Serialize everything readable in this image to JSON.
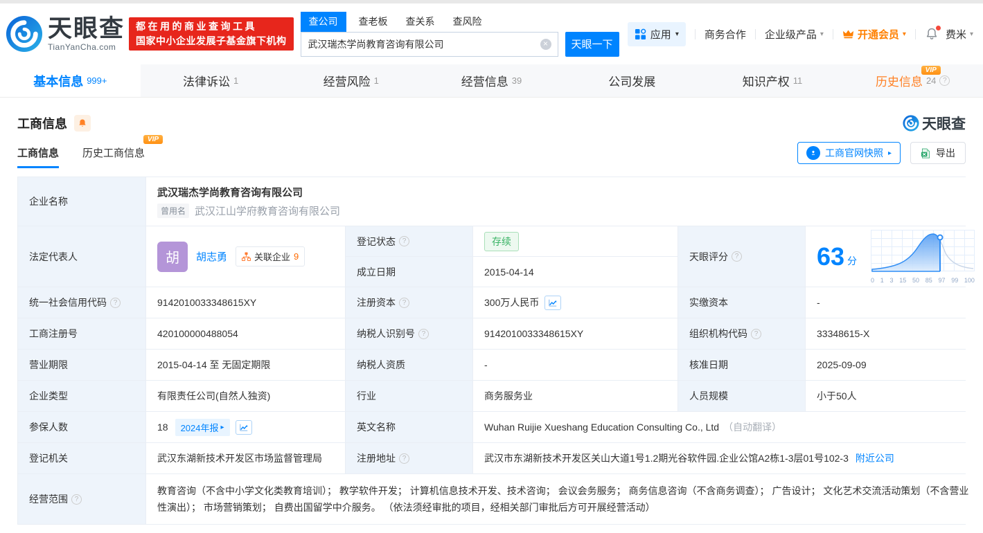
{
  "icons": {
    "help": "?",
    "caret_down": "▾",
    "caret_right": "▸",
    "clear": "×",
    "vip": "VIP"
  },
  "header": {
    "logo": {
      "brand": "天眼查",
      "domain": "TianYanCha.com"
    },
    "banner": {
      "line1": "都在用的商业查询工具",
      "line2": "国家中小企业发展子基金旗下机构"
    },
    "search": {
      "tabs": [
        {
          "label": "查公司"
        },
        {
          "label": "查老板"
        },
        {
          "label": "查关系"
        },
        {
          "label": "查风险"
        }
      ],
      "value": "武汉瑞杰学尚教育咨询有限公司",
      "button": "天眼一下"
    },
    "nav": {
      "apps": "应用",
      "coop": "商务合作",
      "enterprise": "企业级产品",
      "vip": "开通会员",
      "user": "费米"
    }
  },
  "main_tabs": [
    {
      "label": "基本信息",
      "count": "999+"
    },
    {
      "label": "法律诉讼",
      "count": "1"
    },
    {
      "label": "经营风险",
      "count": "1"
    },
    {
      "label": "经营信息",
      "count": "39"
    },
    {
      "label": "公司发展",
      "count": ""
    },
    {
      "label": "知识产权",
      "count": "11"
    },
    {
      "label": "历史信息",
      "count": "24"
    }
  ],
  "section": {
    "title": "工商信息",
    "watermark": "天眼查",
    "subtabs": [
      {
        "label": "工商信息"
      },
      {
        "label": "历史工商信息"
      }
    ],
    "snapshot_button": "工商官网快照",
    "export_button": "导出"
  },
  "table": {
    "company": {
      "label": "企业名称",
      "name": "武汉瑞杰学尚教育咨询有限公司",
      "former_badge": "曾用名",
      "former_name": "武汉江山学府教育咨询有限公司"
    },
    "legal_rep": {
      "label": "法定代表人",
      "avatar": "胡",
      "name": "胡志勇",
      "related_label": "关联企业",
      "related_count": "9"
    },
    "reg_status": {
      "label": "登记状态",
      "value": "存续"
    },
    "est_date": {
      "label": "成立日期",
      "value": "2015-04-14"
    },
    "score": {
      "label": "天眼评分",
      "value": "63",
      "unit": "分"
    },
    "credit_code": {
      "label": "统一社会信用代码",
      "value": "9142010033348615XY"
    },
    "reg_capital": {
      "label": "注册资本",
      "value": "300万人民币"
    },
    "paid_capital": {
      "label": "实缴资本",
      "value": "-"
    },
    "reg_number": {
      "label": "工商注册号",
      "value": "420100000488054"
    },
    "taxpayer_id": {
      "label": "纳税人识别号",
      "value": "9142010033348615XY"
    },
    "org_code": {
      "label": "组织机构代码",
      "value": "33348615-X"
    },
    "business_term": {
      "label": "营业期限",
      "value": "2015-04-14 至 无固定期限"
    },
    "taxpayer_quality": {
      "label": "纳税人资质",
      "value": "-"
    },
    "approval_date": {
      "label": "核准日期",
      "value": "2025-09-09"
    },
    "company_type": {
      "label": "企业类型",
      "value": "有限责任公司(自然人独资)"
    },
    "industry": {
      "label": "行业",
      "value": "商务服务业"
    },
    "staff_size": {
      "label": "人员规模",
      "value": "小于50人"
    },
    "insured": {
      "label": "参保人数",
      "value": "18",
      "report_badge": "2024年报"
    },
    "english_name": {
      "label": "英文名称",
      "value": "Wuhan Ruijie Xueshang Education Consulting Co., Ltd",
      "note": "（自动翻译）"
    },
    "reg_authority": {
      "label": "登记机关",
      "value": "武汉东湖新技术开发区市场监督管理局"
    },
    "reg_address": {
      "label": "注册地址",
      "value": "武汉市东湖新技术开发区关山大道1号1.2期光谷软件园.企业公馆A2栋1-3层01号102-3",
      "link": "附近公司"
    },
    "business_scope": {
      "label": "经营范围",
      "value": "教育咨询（不含中小学文化类教育培训）； 教学软件开发； 计算机信息技术开发、技术咨询； 会议会务服务； 商务信息咨询（不含商务调查）； 广告设计； 文化艺术交流活动策划（不含营业性演出）； 市场营销策划； 自费出国留学中介服务。 （依法须经审批的项目，经相关部门审批后方可开展经营活动）"
    }
  },
  "chart_data": {
    "type": "area",
    "title": "天眼评分分布曲线",
    "score_marker": 63,
    "x_ticks": [
      "0",
      "1",
      "3",
      "15",
      "50",
      "85",
      "97",
      "99",
      "100"
    ],
    "legend_position": "none",
    "grid": true
  }
}
